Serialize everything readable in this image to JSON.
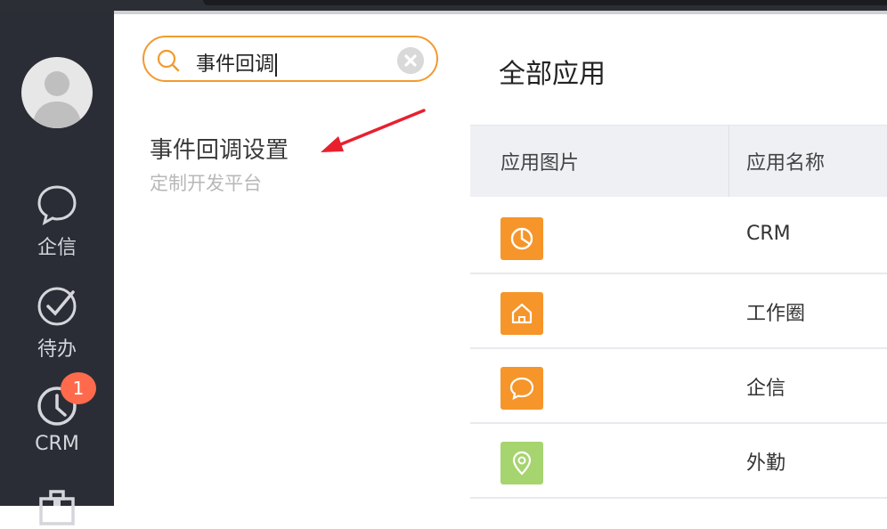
{
  "nav": {
    "items": [
      {
        "label": "企信",
        "icon": "chat-bubble-icon"
      },
      {
        "label": "待办",
        "icon": "check-circle-icon"
      },
      {
        "label": "CRM",
        "icon": "clock-icon",
        "badge": "1"
      },
      {
        "label": "",
        "icon": "briefcase-icon"
      }
    ]
  },
  "search": {
    "value": "事件回调"
  },
  "result": {
    "title": "事件回调设置",
    "subtitle": "定制开发平台"
  },
  "main": {
    "title": "全部应用",
    "columns": [
      "应用图片",
      "应用名称"
    ],
    "rows": [
      {
        "name": "CRM",
        "icon": "pie-chart-icon",
        "color": "#f6952a"
      },
      {
        "name": "工作圈",
        "icon": "home-icon",
        "color": "#f6952a"
      },
      {
        "name": "企信",
        "icon": "chat-bubble-icon",
        "color": "#f6952a"
      },
      {
        "name": "外勤",
        "icon": "location-pin-icon",
        "color": "#a6d46f"
      }
    ]
  },
  "colors": {
    "accent": "#f29a2e",
    "badge": "#ff6a4d",
    "nav_bg": "#2a2d35",
    "arrow": "#e8202e"
  }
}
